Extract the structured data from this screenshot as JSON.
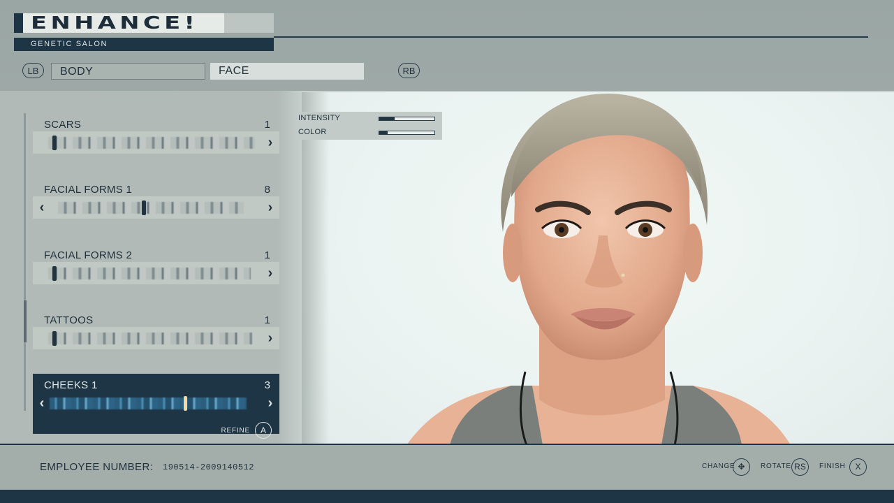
{
  "header": {
    "title": "ENHANCE!",
    "subtitle": "GENETIC SALON"
  },
  "tabs": {
    "prev_button": "LB",
    "next_button": "RB",
    "items": [
      {
        "label": "BODY",
        "active": false
      },
      {
        "label": "FACE",
        "active": true
      }
    ]
  },
  "options": [
    {
      "label": "SCARS",
      "count": "1",
      "has_prev": false,
      "position": 0.02,
      "selected": false
    },
    {
      "label": "FACIAL FORMS 1",
      "count": "8",
      "has_prev": true,
      "position": 0.45,
      "selected": false
    },
    {
      "label": "FACIAL FORMS 2",
      "count": "1",
      "has_prev": false,
      "position": 0.02,
      "selected": false
    },
    {
      "label": "TATTOOS",
      "count": "1",
      "has_prev": false,
      "position": 0.02,
      "selected": false
    },
    {
      "label": "CHEEKS 1",
      "count": "3",
      "has_prev": true,
      "position": 0.68,
      "selected": true
    }
  ],
  "refine": {
    "label": "REFINE",
    "button": "A"
  },
  "adjustments": [
    {
      "label": "INTENSITY",
      "level": 0.28
    },
    {
      "label": "COLOR",
      "level": 0.15
    }
  ],
  "footer": {
    "employee_label": "EMPLOYEE NUMBER:",
    "employee_value": "190514-2009140512",
    "hints": [
      {
        "label": "CHANGE",
        "button": "✥"
      },
      {
        "label": "ROTATE",
        "button": "RS"
      },
      {
        "label": "FINISH",
        "button": "X"
      }
    ]
  },
  "colors": {
    "navy": "#1e3545",
    "panel": "#b1bab6",
    "preview_bg": "#eaf3f1"
  }
}
